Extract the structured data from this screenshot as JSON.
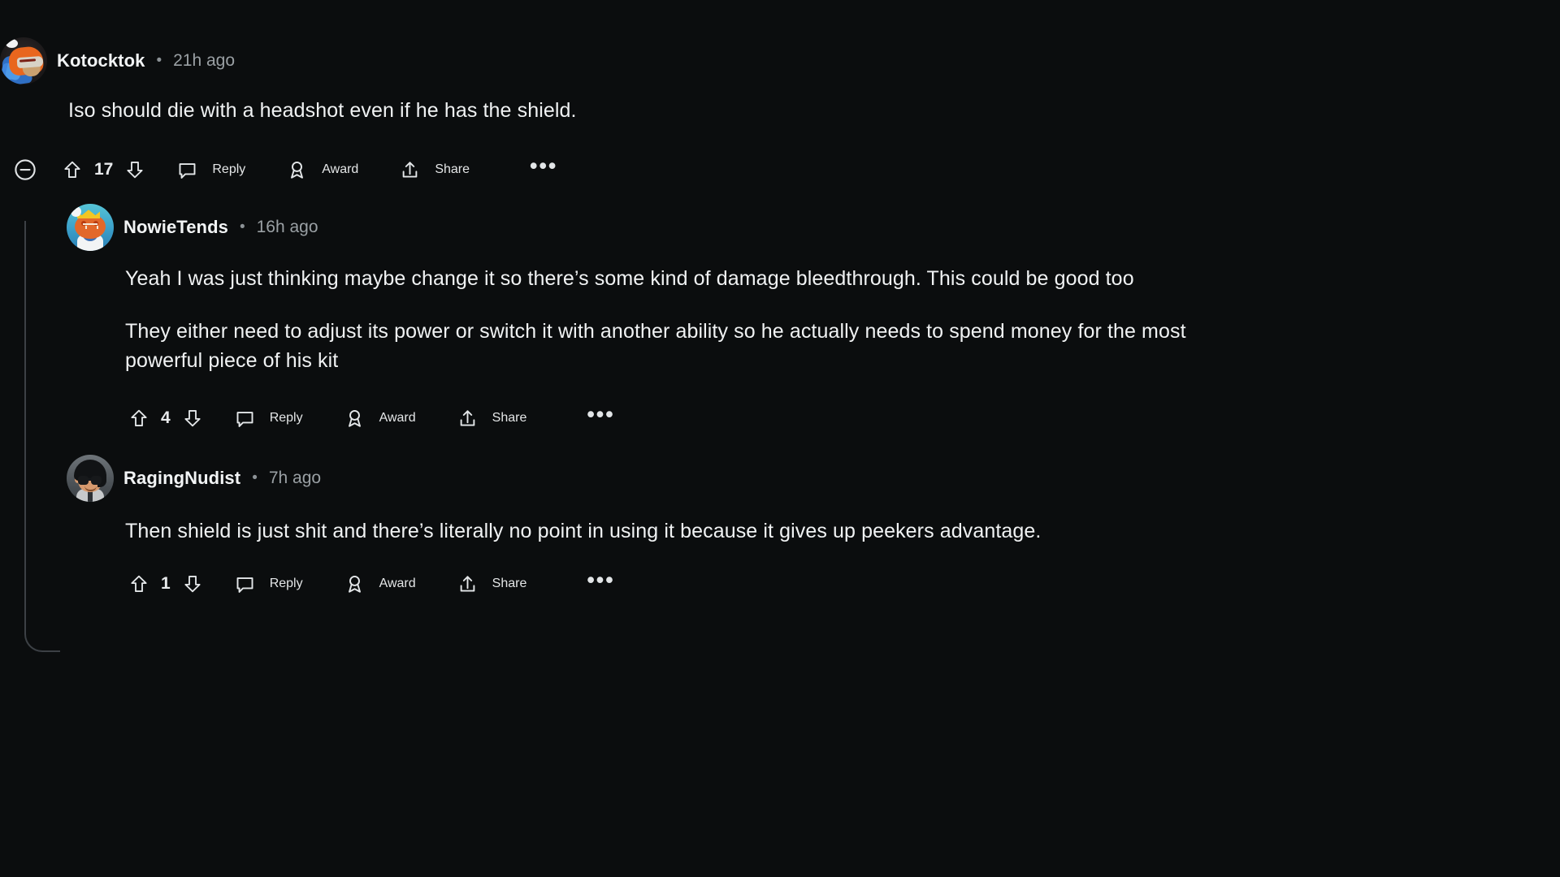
{
  "theme": {
    "background": "#0b0d0e",
    "text_primary": "#f0f2f3",
    "text_muted": "#9aa0a4",
    "threadline": "#3c4045"
  },
  "action_labels": {
    "reply": "Reply",
    "award": "Award",
    "share": "Share",
    "more": "•••",
    "separator": "•"
  },
  "comments": [
    {
      "id": "root",
      "username": "Kotocktok",
      "timestamp": "21h ago",
      "avatar": "kotocktok-avatar",
      "paragraphs": [
        "Iso should die with a headshot even if he has the shield."
      ],
      "votes": "17",
      "collapsible": true
    },
    {
      "id": "child",
      "username": "NowieTends",
      "timestamp": "16h ago",
      "avatar": "nowietends-avatar",
      "paragraphs": [
        "Yeah I was just thinking maybe change it so there’s some kind of damage bleedthrough. This could be good too",
        "They either need to adjust its power or switch it with another ability so he actually needs to spend money for the most powerful piece of his kit"
      ],
      "votes": "4",
      "collapsible": false
    },
    {
      "id": "grandchild",
      "username": "RagingNudist",
      "timestamp": "7h ago",
      "avatar": "ragingnudist-avatar",
      "paragraphs": [
        "Then shield is just shit and there’s literally no point in using it because it gives up peekers advantage."
      ],
      "votes": "1",
      "collapsible": false
    }
  ]
}
